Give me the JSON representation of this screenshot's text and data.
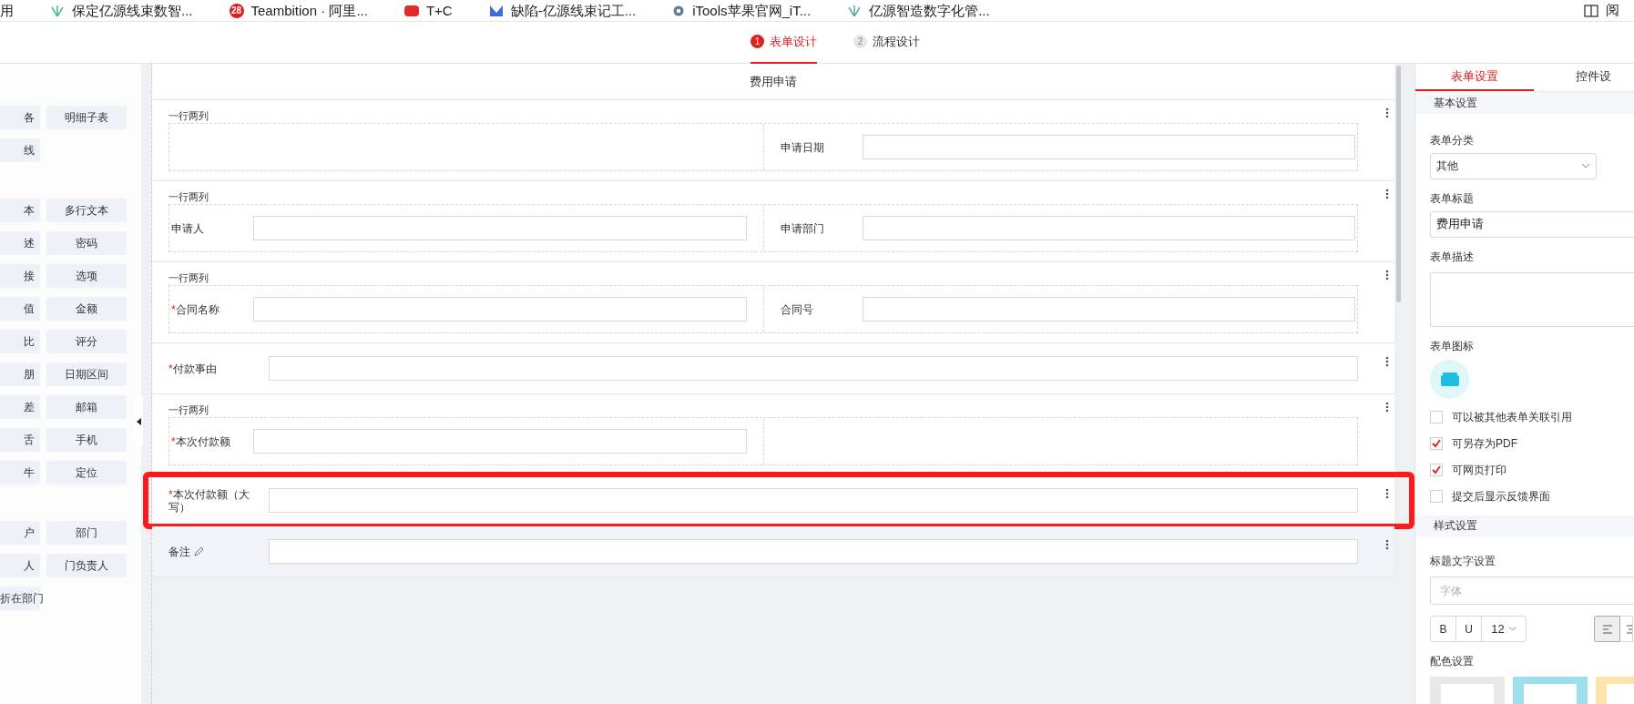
{
  "bookmarks": [
    {
      "label": "用"
    },
    {
      "label": "保定亿源线束数智..."
    },
    {
      "label": "Teambition · 阿里...",
      "badge": "28"
    },
    {
      "label": "T+C"
    },
    {
      "label": "缺陷-亿源线束记工..."
    },
    {
      "label": "iTools苹果官网_iT..."
    },
    {
      "label": "亿源智造数字化管..."
    }
  ],
  "bookmarks_right": "阅",
  "steps": [
    {
      "number": "1",
      "label": "表单设计",
      "selected": true
    },
    {
      "number": "2",
      "label": "流程设计",
      "selected": false
    }
  ],
  "palette": {
    "groups": [
      [
        "各",
        "明细子表",
        "线"
      ],
      [
        "本",
        "多行文本",
        "述",
        "密码",
        "接",
        "选项",
        "值",
        "金额",
        "比",
        "评分",
        "朋",
        "日期区间",
        "差",
        "邮箱",
        "舌",
        "手机",
        "牛",
        "定位"
      ],
      [
        "户",
        "部门",
        "人",
        "门负责人",
        "折在部门"
      ]
    ]
  },
  "form": {
    "title": "费用申请",
    "rows": [
      {
        "kind": "two",
        "caption": "一行两列",
        "cells": [
          null,
          {
            "label": "申请日期"
          }
        ]
      },
      {
        "kind": "two",
        "caption": "一行两列",
        "cells": [
          {
            "label": "申请人"
          },
          {
            "label": "申请部门"
          }
        ]
      },
      {
        "kind": "two",
        "caption": "一行两列",
        "cells": [
          {
            "label": "合同名称",
            "required_mark": "*"
          },
          {
            "label": "合同号"
          }
        ]
      },
      {
        "kind": "single",
        "label": "付款事由",
        "required_mark": "*",
        "highlighted": false,
        "active": false,
        "editable": false
      },
      {
        "kind": "two",
        "caption": "一行两列",
        "cells": [
          {
            "label": "本次付款额",
            "required_mark": "*"
          },
          null
        ]
      },
      {
        "kind": "single",
        "label": "本次付款额（大写）",
        "required_mark": "*",
        "highlighted": true,
        "active": false,
        "editable": false
      },
      {
        "kind": "single",
        "label": "备注",
        "highlighted": false,
        "active": true,
        "editable": true
      }
    ]
  },
  "settings": {
    "tabs": [
      {
        "label": "表单设置",
        "selected": true
      },
      {
        "label": "控件设",
        "selected": false
      }
    ],
    "basic_header": "基本设置",
    "category": {
      "label": "表单分类",
      "value": "其他"
    },
    "title": {
      "label": "表单标题",
      "value": "费用申请"
    },
    "description": {
      "label": "表单描述"
    },
    "icon_label": "表单图标",
    "options": [
      {
        "label": "可以被其他表单关联引用",
        "checked": false
      },
      {
        "label": "可另存为PDF",
        "checked": true
      },
      {
        "label": "可网页打印",
        "checked": true
      },
      {
        "label": "提交后显示反馈界面",
        "checked": false
      }
    ],
    "style_header": "样式设置",
    "title_font_label": "标题文字设置",
    "font": {
      "placeholder": "字体"
    },
    "format": {
      "bold": "B",
      "underline": "U",
      "size": "12"
    },
    "colors_label": "配色设置",
    "swatches": [
      {
        "color": "#e8e8e8"
      },
      {
        "color": "#9be0ec"
      },
      {
        "color": "#fde4a8"
      }
    ]
  }
}
